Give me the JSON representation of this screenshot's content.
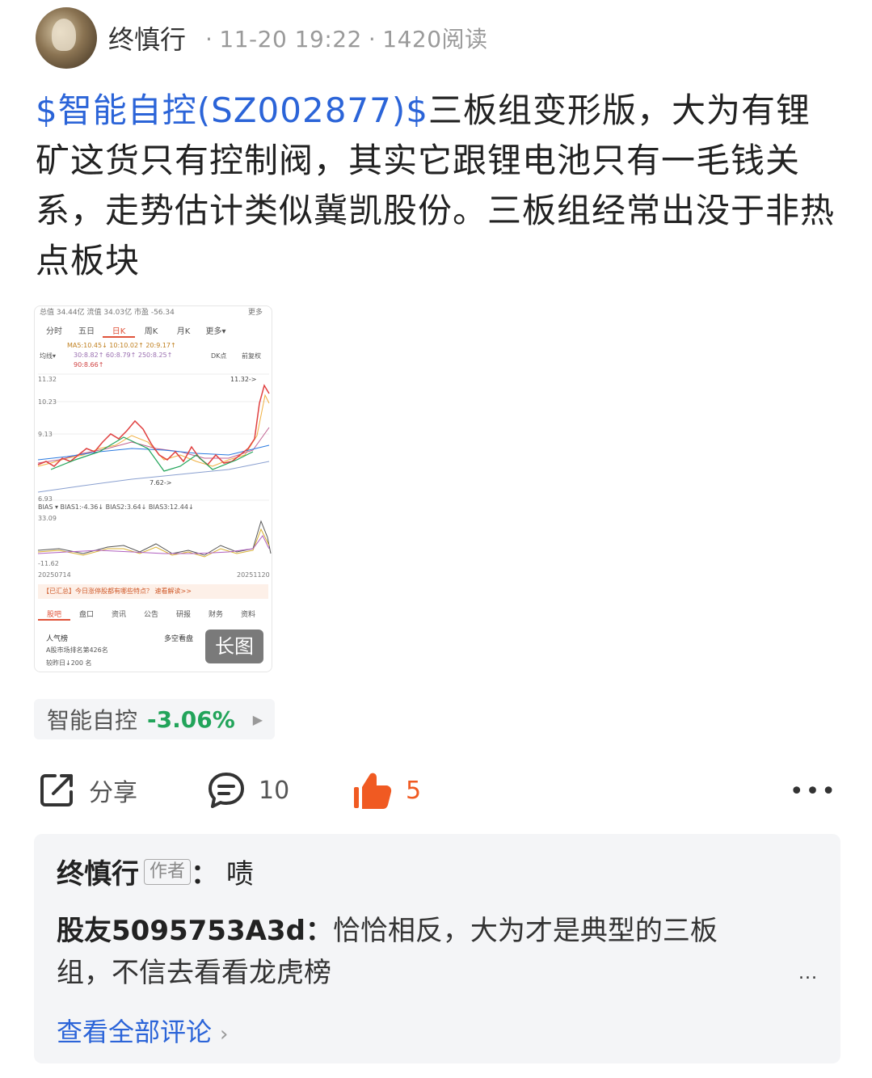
{
  "header": {
    "author": "终慎行",
    "time": "11-20 19:22",
    "reads": "1420阅读",
    "separator": "·"
  },
  "post": {
    "stock_tag": "$智能自控(SZ002877)$",
    "text": "三板组变形版，大为有锂矿这货只有控制阀，其实它跟锂电池只有一毛钱关系，走势估计类似冀凯股份。三板组经常出没于非热点板块"
  },
  "thumbnail": {
    "top_line": "总值 34.44亿  流值 34.03亿  市盈 -56.34",
    "top_more": "更多",
    "tabs": [
      "分时",
      "五日",
      "日K",
      "周K",
      "月K",
      "更多▾"
    ],
    "active_tab": "日K",
    "ma_line1": "MA5:10.45↓   10:10.02↑   20:9.17↑",
    "ma_line2": "30:8.82↑   60:8.79↑   250:8.25↑",
    "ma_line3": "90:8.66↑",
    "ma_label": "均线▾",
    "dk_label": "DK点",
    "fq_label": "前复权",
    "price_high": "11.32",
    "price_mid": "10.23",
    "price_low": "9.13",
    "price_bottom": "6.93",
    "price_max_tag": "11.32->",
    "price_min_tag": "7.62->",
    "bias_label": "BIAS ▾ BIAS1:-4.36↓  BIAS2:3.64↓  BIAS3:12.44↓",
    "bias_high": "33.09",
    "bias_low": "-11.62",
    "date_start": "20250714",
    "date_end": "20251120",
    "notice": "【已汇总】今日涨停股都有哪些特点？ 速看解读>>",
    "sub_tabs": [
      "股吧",
      "盘口",
      "资讯",
      "公告",
      "研报",
      "财务",
      "资料"
    ],
    "rank_title": "人气榜",
    "rank_line1": "A股市场排名第426名",
    "rank_line2": "较昨日↓200 名",
    "view_title": "多空看盘",
    "long_badge": "长图"
  },
  "stock_chip": {
    "name": "智能自控",
    "change": "-3.06%",
    "change_color": "#22a45a"
  },
  "actions": {
    "share": "分享",
    "comments": "10",
    "likes": "5",
    "like_color": "#f05a22"
  },
  "comments": {
    "c1_author": "终慎行",
    "c1_tag": "作者",
    "c1_sep": "：",
    "c1_text": "啧",
    "c2_author": "股友5095753A3d",
    "c2_sep": "：",
    "c2_text": "恰恰相反，大为才是典型的三板组，不信去看看龙虎榜",
    "more": "...",
    "view_all": "查看全部评论"
  }
}
